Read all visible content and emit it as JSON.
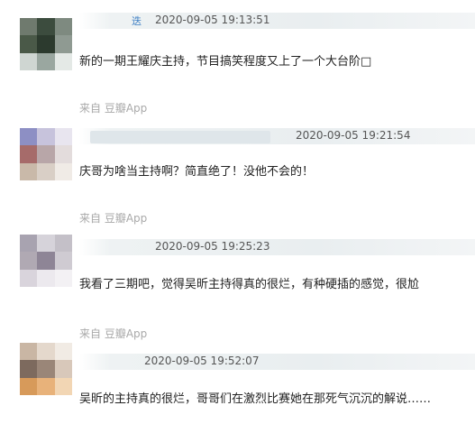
{
  "comments": [
    {
      "timestamp": "2020-09-05 19:13:51",
      "text": "新的一期王耀庆主持，节目搞笑程度又上了一个大台阶□",
      "edge_glyph": "迭",
      "source": "来自 豆瓣App",
      "avatar_colors": [
        "#6f7a6e",
        "#3c4c3e",
        "#7e8a80",
        "#4a5948",
        "#2c3a2e",
        "#8f9a92",
        "#cfd6d2",
        "#9aa7a0",
        "#e4e9e6"
      ]
    },
    {
      "timestamp": "2020-09-05 19:21:54",
      "text": "庆哥为啥当主持啊？简直绝了！没他不会的！",
      "edge_glyph": "",
      "source": "来自 豆瓣App",
      "avatar_colors": [
        "#8d8fc4",
        "#c7c3dc",
        "#e8e5ef",
        "#a66b6a",
        "#b8a6a8",
        "#e3dcdc",
        "#c9b9a9",
        "#d9cfc6",
        "#f0ebe6"
      ]
    },
    {
      "timestamp": "2020-09-05 19:25:23",
      "text": "我看了三期吧，觉得吴昕主持得真的很烂，有种硬插的感觉，很尬",
      "edge_glyph": "",
      "source": "来自 豆瓣App",
      "avatar_colors": [
        "#a8a3b0",
        "#d6d3da",
        "#c4c0c8",
        "#b0a9b3",
        "#8e8596",
        "#cfcbd2",
        "#d9d4dc",
        "#ece9ee",
        "#f3f1f4"
      ]
    },
    {
      "timestamp": "2020-09-05 19:52:07",
      "text": "吴昕的主持真的很烂，哥哥们在激烈比赛她在那死气沉沉的解说……",
      "edge_glyph": "",
      "source": "",
      "avatar_colors": [
        "#c9b6a4",
        "#e4d8cc",
        "#f1ebe4",
        "#7d6a5e",
        "#9a8678",
        "#d8c8ba",
        "#d79a5a",
        "#e8b27a",
        "#f2d6b4"
      ]
    }
  ]
}
